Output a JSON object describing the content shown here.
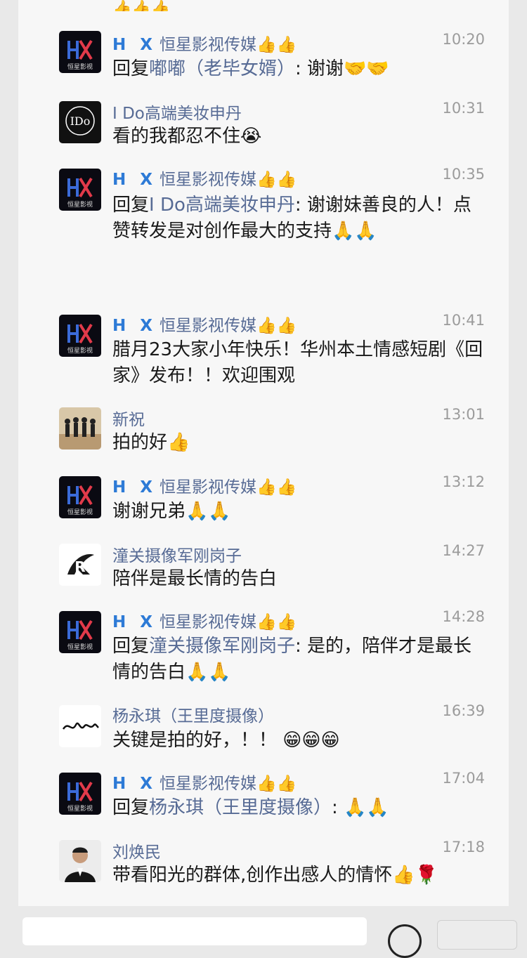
{
  "top_partial": {
    "emoji": "👍👍👍"
  },
  "comments": [
    {
      "name_label": "H X",
      "name_rest": "恒星影视传媒👍👍",
      "time": "10:20",
      "prefix": "回复",
      "mention": "嘟嘟（老毕女婿）",
      "text": ": 谢谢🤝🤝",
      "avatar": "hx-logo"
    },
    {
      "name_label": "",
      "name_rest": "I Do高端美妆申丹",
      "time": "10:31",
      "prefix": "",
      "mention": "",
      "text": "看的我都忍不住😭",
      "avatar": "ido-logo"
    },
    {
      "name_label": "H X",
      "name_rest": "恒星影视传媒👍👍",
      "time": "10:35",
      "prefix": "回复",
      "mention": "I Do高端美妆申丹",
      "text": ": 谢谢妹善良的人！点赞转发是对创作最大的支持🙏🙏",
      "avatar": "hx-logo"
    },
    {
      "name_label": "H X",
      "name_rest": "恒星影视传媒👍👍",
      "time": "10:41",
      "prefix": "",
      "mention": "",
      "text": "腊月23大家小年快乐！华州本土情感短剧《回家》发布！！欢迎围观",
      "avatar": "hx-logo"
    },
    {
      "name_label": "",
      "name_rest": "新祝",
      "time": "13:01",
      "prefix": "",
      "mention": "",
      "text": "拍的好👍",
      "avatar": "group-photo"
    },
    {
      "name_label": "H X",
      "name_rest": "恒星影视传媒👍👍",
      "time": "13:12",
      "prefix": "",
      "mention": "",
      "text": "谢谢兄弟🙏🙏",
      "avatar": "hx-logo"
    },
    {
      "name_label": "",
      "name_rest": "潼关摄像军刚岗子",
      "time": "14:27",
      "prefix": "",
      "mention": "",
      "text": "陪伴是最长情的告白",
      "avatar": "r-logo"
    },
    {
      "name_label": "H X",
      "name_rest": "恒星影视传媒👍👍",
      "time": "14:28",
      "prefix": "回复",
      "mention": "潼关摄像军刚岗子",
      "text": ": 是的，陪伴才是最长情的告白🙏🙏",
      "avatar": "hx-logo"
    },
    {
      "name_label": "",
      "name_rest": "杨永琪（王里度摄像）",
      "time": "16:39",
      "prefix": "",
      "mention": "",
      "text": "关键是拍的好，！！ 😁😁😁",
      "avatar": "signature-logo"
    },
    {
      "name_label": "H X",
      "name_rest": "恒星影视传媒👍👍",
      "time": "17:04",
      "prefix": "回复",
      "mention": "杨永琪（王里度摄像）",
      "text": ": 🙏🙏",
      "avatar": "hx-logo"
    },
    {
      "name_label": "",
      "name_rest": "刘焕民",
      "time": "17:18",
      "prefix": "",
      "mention": "",
      "text": "带看阳光的群体,创作出感人的情怀👍🌹",
      "avatar": "portrait"
    }
  ],
  "colors": {
    "name_blue": "#576b95",
    "hx_blue": "#2d7ad6",
    "page_bg": "#f7f7f7"
  }
}
